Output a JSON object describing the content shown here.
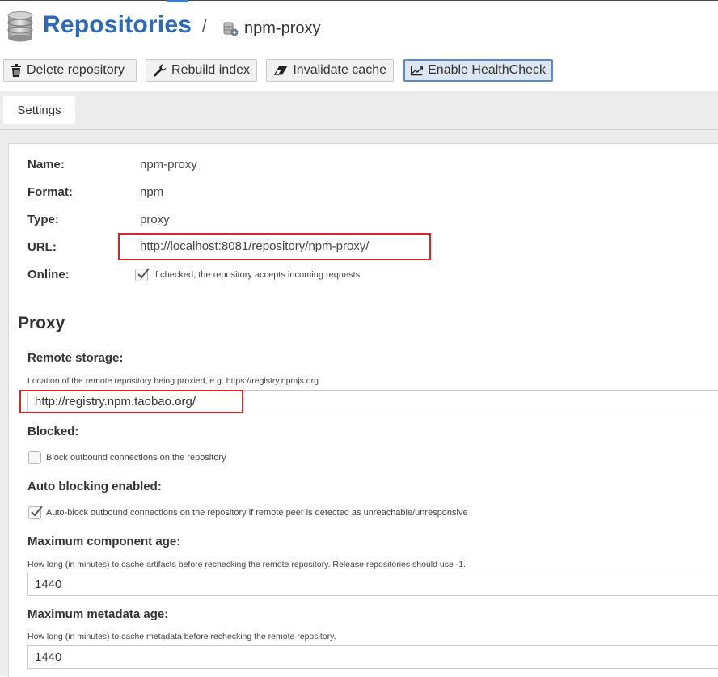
{
  "header": {
    "title": "Repositories",
    "separator": "/",
    "current_repo": "npm-proxy",
    "title_icon": "database-icon",
    "repo_icon": "proxy-repository-icon"
  },
  "toolbar": {
    "buttons": [
      {
        "label": "Delete repository",
        "icon": "trash-icon"
      },
      {
        "label": "Rebuild index",
        "icon": "wrench-icon"
      },
      {
        "label": "Invalidate cache",
        "icon": "eraser-icon"
      },
      {
        "label": "Enable HealthCheck",
        "icon": "chart-line-icon"
      }
    ]
  },
  "tabs": [
    {
      "label": "Settings",
      "selected": true
    }
  ],
  "summary": {
    "name_label": "Name:",
    "name_value": "npm-proxy",
    "format_label": "Format:",
    "format_value": "npm",
    "type_label": "Type:",
    "type_value": "proxy",
    "url_label": "URL:",
    "url_value": "http://localhost:8081/repository/npm-proxy/",
    "online_label": "Online:",
    "online_checked": true,
    "online_text": "If checked, the repository accepts incoming requests"
  },
  "proxy": {
    "section_title": "Proxy",
    "remote_storage_label": "Remote storage:",
    "remote_storage_help": "Location of the remote repository being proxied, e.g. https://registry.npmjs.org",
    "remote_storage_value": "http://registry.npm.taobao.org/",
    "blocked_label": "Blocked:",
    "blocked_checked": false,
    "blocked_text": "Block outbound connections on the repository",
    "auto_blocking_label": "Auto blocking enabled:",
    "auto_blocking_checked": true,
    "auto_blocking_text": "Auto-block outbound connections on the repository if remote peer is detected as unreachable/unresponsive",
    "max_component_age_label": "Maximum component age:",
    "max_component_age_help": "How long (in minutes) to cache artifacts before rechecking the remote repository. Release repositories should use -1.",
    "max_component_age_value": "1440",
    "max_metadata_age_label": "Maximum metadata age:",
    "max_metadata_age_help": "How long (in minutes) to cache metadata before rechecking the remote repository.",
    "max_metadata_age_value": "1440"
  },
  "colors": {
    "title": "#2a6ab8",
    "highlight_box": "#d9242c",
    "active_button": "#5b8bc6"
  }
}
